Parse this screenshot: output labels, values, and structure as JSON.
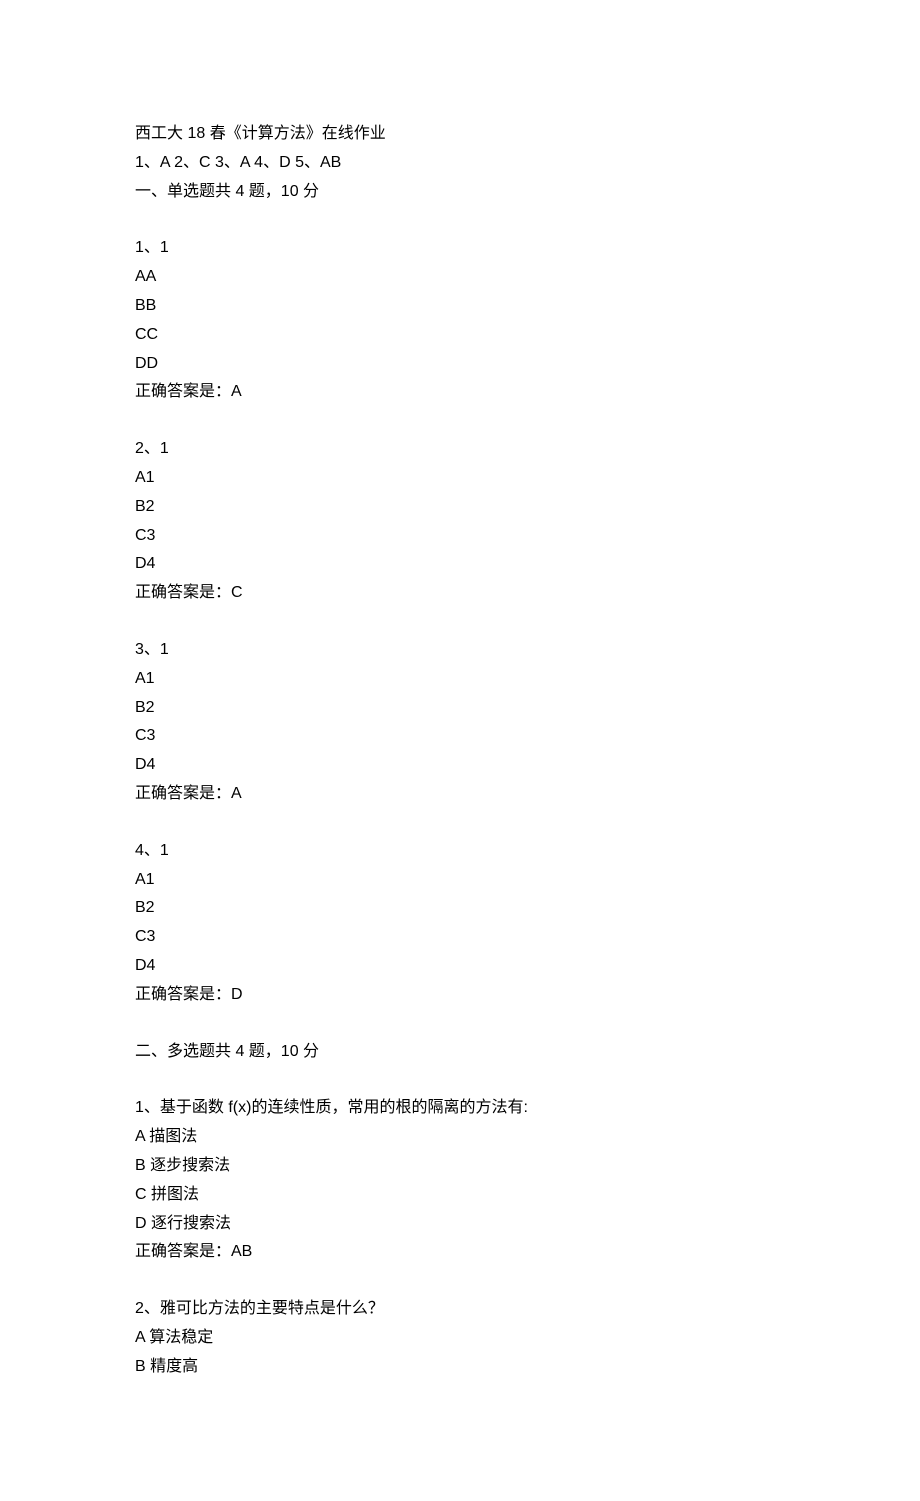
{
  "header": {
    "title": "西工大 18 春《计算方法》在线作业",
    "answer_key": "1、A 2、C 3、A 4、D 5、AB",
    "section1_title": "一、单选题共 4 题，10 分"
  },
  "single_choice": [
    {
      "number": "1、1",
      "options": [
        "AA",
        "BB",
        "CC",
        "DD"
      ],
      "answer": "正确答案是：A"
    },
    {
      "number": "2、1",
      "options": [
        "A1",
        "B2",
        "C3",
        "D4"
      ],
      "answer": "正确答案是：C"
    },
    {
      "number": "3、1",
      "options": [
        "A1",
        "B2",
        "C3",
        "D4"
      ],
      "answer": "正确答案是：A"
    },
    {
      "number": "4、1",
      "options": [
        "A1",
        "B2",
        "C3",
        "D4"
      ],
      "answer": "正确答案是：D"
    }
  ],
  "section2_title": "二、多选题共 4 题，10 分",
  "multi_choice": [
    {
      "number": "1、基于函数 f(x)的连续性质，常用的根的隔离的方法有:",
      "options": [
        "A 描图法",
        "B 逐步搜索法",
        "C 拼图法",
        "D 逐行搜索法"
      ],
      "answer": "正确答案是：AB"
    },
    {
      "number": "2、雅可比方法的主要特点是什么？",
      "options": [
        "A 算法稳定",
        "B 精度高"
      ],
      "answer": ""
    }
  ]
}
